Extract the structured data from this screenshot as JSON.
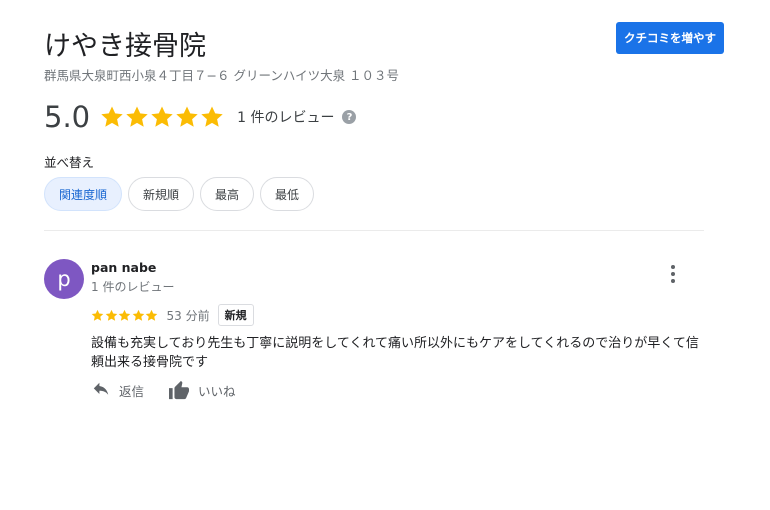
{
  "business": {
    "name": "けやき接骨院",
    "address": "群馬県大泉町西小泉４丁目７−６ グリーンハイツ大泉 １０３号",
    "add_review_label": "クチコミを増やす"
  },
  "rating": {
    "value": "5.0",
    "stars": 5,
    "review_count_text": "1 件のレビュー",
    "help_icon": "?"
  },
  "sort": {
    "label": "並べ替え",
    "options": [
      "関連度順",
      "新規順",
      "最高",
      "最低"
    ],
    "selected": 0
  },
  "review": {
    "avatar_letter": "p",
    "author": "pan nabe",
    "author_meta": "1 件のレビュー",
    "stars": 5,
    "time": "53 分前",
    "badge": "新規",
    "text": "設備も充実しており先生も丁寧に説明をしてくれて痛い所以外にもケアをしてくれるので治りが早くて信頼出来る接骨院です",
    "reply_label": "返信",
    "like_label": "いいね"
  },
  "colors": {
    "accent": "#1a73e8",
    "star": "#fbbc04",
    "avatar": "#7e57c2",
    "chip_active_bg": "#e8f0fe"
  },
  "icons": [
    "star-icon",
    "help-icon",
    "more-vert-icon",
    "reply-icon",
    "thumb-up-icon"
  ]
}
